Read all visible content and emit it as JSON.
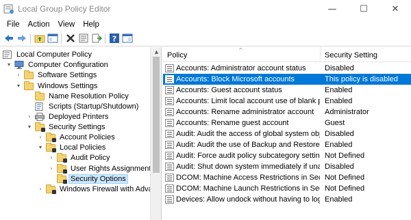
{
  "window": {
    "title": "Local Group Policy Editor",
    "controls": {
      "minimize": "—",
      "maximize": "☐",
      "close": "✕"
    }
  },
  "menu": [
    "File",
    "Action",
    "View",
    "Help"
  ],
  "toolbar": {
    "buttons": [
      "back-arrow-icon",
      "forward-arrow-icon",
      "up-folder-icon",
      "show-hide-tree-icon",
      "delete-icon",
      "properties-icon",
      "export-list-icon",
      "help-icon",
      "console-view-icon"
    ]
  },
  "tree": {
    "items": [
      {
        "label": "Local Computer Policy",
        "level": 0,
        "expanded": null,
        "icon": "policy-icon"
      },
      {
        "label": "Computer Configuration",
        "level": 1,
        "expanded": true,
        "icon": "computer-icon"
      },
      {
        "label": "Software Settings",
        "level": 2,
        "expanded": false,
        "icon": "folder-icon"
      },
      {
        "label": "Windows Settings",
        "level": 2,
        "expanded": true,
        "icon": "folder-icon"
      },
      {
        "label": "Name Resolution Policy",
        "level": 3,
        "expanded": null,
        "icon": "folder-icon"
      },
      {
        "label": "Scripts (Startup/Shutdown)",
        "level": 3,
        "expanded": null,
        "icon": "script-icon"
      },
      {
        "label": "Deployed Printers",
        "level": 3,
        "expanded": false,
        "icon": "printer-icon"
      },
      {
        "label": "Security Settings",
        "level": 3,
        "expanded": true,
        "icon": "security-folder-icon"
      },
      {
        "label": "Account Policies",
        "level": 4,
        "expanded": false,
        "icon": "security-folder-icon"
      },
      {
        "label": "Local Policies",
        "level": 4,
        "expanded": true,
        "icon": "security-folder-icon"
      },
      {
        "label": "Audit Policy",
        "level": 5,
        "expanded": false,
        "icon": "security-folder-icon"
      },
      {
        "label": "User Rights Assignment",
        "level": 5,
        "expanded": false,
        "icon": "security-folder-icon"
      },
      {
        "label": "Security Options",
        "level": 5,
        "expanded": null,
        "icon": "security-folder-icon",
        "selected": true
      },
      {
        "label": "Windows Firewall with Advan",
        "level": 4,
        "expanded": false,
        "icon": "security-folder-icon"
      }
    ]
  },
  "list": {
    "columns": [
      "Policy",
      "Security Setting"
    ],
    "sort_indicator": "^",
    "rows": [
      {
        "policy": "Accounts: Administrator account status",
        "setting": "Disabled"
      },
      {
        "policy": "Accounts: Block Microsoft accounts",
        "setting": "This policy is disabled",
        "selected": true
      },
      {
        "policy": "Accounts: Guest account status",
        "setting": "Enabled"
      },
      {
        "policy": "Accounts: Limit local account use of blank p...",
        "setting": "Enabled"
      },
      {
        "policy": "Accounts: Rename administrator account",
        "setting": "Administrator"
      },
      {
        "policy": "Accounts: Rename guest account",
        "setting": "Guest"
      },
      {
        "policy": "Audit: Audit the access of global system obje...",
        "setting": "Disabled"
      },
      {
        "policy": "Audit: Audit the use of Backup and Restore p...",
        "setting": "Enabled"
      },
      {
        "policy": "Audit: Force audit policy subcategory setting...",
        "setting": "Not Defined"
      },
      {
        "policy": "Audit: Shut down system immediately if una...",
        "setting": "Disabled"
      },
      {
        "policy": "DCOM: Machine Access Restrictions in Securi...",
        "setting": "Not Defined"
      },
      {
        "policy": "DCOM: Machine Launch Restrictions in Secur...",
        "setting": "Not Defined"
      },
      {
        "policy": "Devices: Allow undock without having to log ...",
        "setting": "Enabled"
      }
    ]
  },
  "colors": {
    "selection": "#0078d7",
    "tree_selection": "#cce8ff",
    "folder": "#f3d371"
  }
}
